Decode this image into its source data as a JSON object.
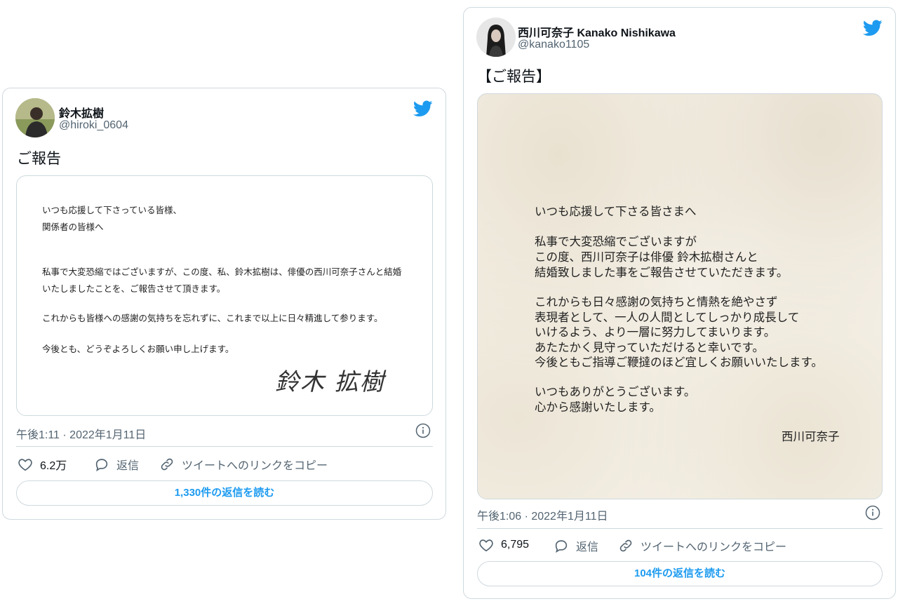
{
  "left": {
    "name": "鈴木拡樹",
    "handle": "@hiroki_0604",
    "text": "ご報告",
    "letter": {
      "l1": "いつも応援して下さっている皆様、",
      "l2": "関係者の皆様へ",
      "l3": "私事で大変恐縮ではございますが、この度、私、鈴木拡樹は、俳優の西川可奈子さんと結婚",
      "l4": "いたしましたことを、ご報告させて頂きます。",
      "l5": "これからも皆様への感謝の気持ちを忘れずに、これまで以上に日々精進して参ります。",
      "l6": "今後とも、どうぞよろしくお願い申し上げます。",
      "signature": "鈴木 拡樹"
    },
    "timestamp": "午後1:11 · 2022年1月11日",
    "likes": "6.2万",
    "reply_label": "返信",
    "copy_label": "ツイートへのリンクをコピー",
    "read_replies": "1,330件の返信を読む"
  },
  "right": {
    "name": "西川可奈子 Kanako Nishikawa",
    "handle": "@kanako1105",
    "text": "【ご報告】",
    "letter": {
      "l1": "いつも応援して下さる皆さまへ",
      "l2": "私事で大変恐縮でございますが",
      "l3": "この度、西川可奈子は俳優 鈴木拡樹さんと",
      "l4": "結婚致しました事をご報告させていただきます。",
      "l5": "これからも日々感謝の気持ちと情熱を絶やさず",
      "l6": "表現者として、一人の人間としてしっかり成長して",
      "l7": "いけるよう、より一層に努力してまいります。",
      "l8": "あたたかく見守っていただけると幸いです。",
      "l9": "今後ともご指導ご鞭撻のほど宜しくお願いいたします。",
      "l10": "いつもありがとうございます。",
      "l11": "心から感謝いたします。",
      "signature": "西川可奈子"
    },
    "timestamp": "午後1:06 · 2022年1月11日",
    "likes": "6,795",
    "reply_label": "返信",
    "copy_label": "ツイートへのリンクをコピー",
    "read_replies": "104件の返信を読む"
  },
  "colors": {
    "accent": "#1d9bf0",
    "muted": "#536471",
    "border": "#cfd9de"
  },
  "icons": [
    "twitter-bird-icon",
    "info-icon",
    "heart-icon",
    "reply-bubble-icon",
    "link-icon"
  ]
}
